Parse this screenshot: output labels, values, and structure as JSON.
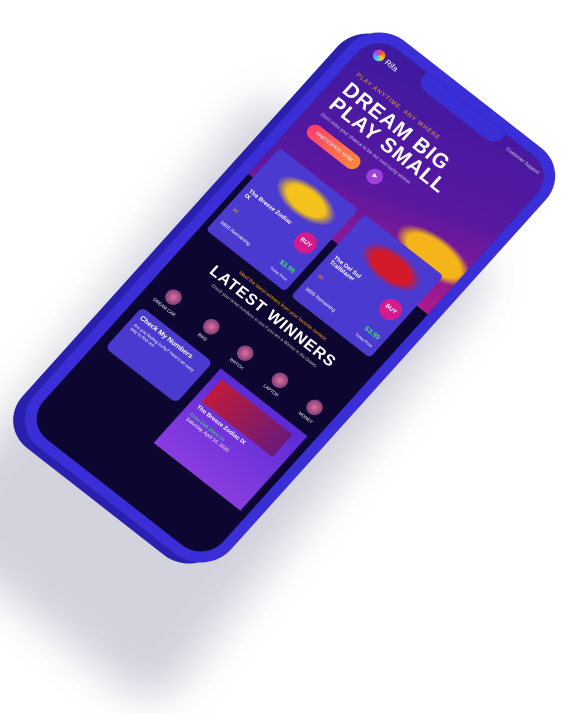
{
  "header": {
    "logo": "Rifa",
    "status": "Customer Support"
  },
  "hero": {
    "tagline": "PLAY ANYTIME, ANY WHERE",
    "title_line1": "DREAM BIG",
    "title_line2": "PLAY SMALL",
    "subtitle": "Don't miss your chance to be our next lucky winner",
    "cta": "PARTICIPATE NOW",
    "play": "▶"
  },
  "cards": [
    {
      "name": "The Breeze Zodiac IX",
      "buy": "BUY",
      "days": "3d",
      "remaining": "9805 Remaining",
      "price": "$3.99",
      "price_label": "Ticket Price",
      "color": "#f4c21a"
    },
    {
      "name": "The Del Sol Trailblazer",
      "buy": "BUY",
      "days": "3d",
      "remaining": "9805 Remaining",
      "price": "$3.99",
      "price_label": "Ticket Price",
      "color": "#d41a2a"
    }
  ],
  "winners": {
    "meet": "Meet the latest winners from your favorite contest",
    "title": "LATEST WINNERS",
    "subtitle": "Check your ticket numbers to see if you are a Winner in the Draws.",
    "categories": [
      "DREAM CAR",
      "BIKE",
      "WATCH",
      "LAPTOP",
      "MONEY"
    ]
  },
  "check": {
    "title": "Check My Numbers",
    "text": "Are you feeling lucky? Here's an easy way to find out"
  },
  "winner_card": {
    "name": "The Breeze Zodiac IX",
    "draw": "Draw took place on",
    "date": "Saturday, April 10, 2020"
  }
}
